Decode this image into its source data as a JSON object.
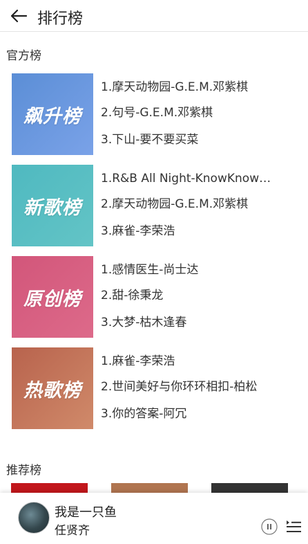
{
  "header": {
    "title": "排行榜",
    "back_icon": "arrow-left-icon"
  },
  "official": {
    "title": "官方榜",
    "charts": [
      {
        "cover_text": "飙升榜",
        "cover_colors": [
          "#5b8ed6",
          "#7aa2e8"
        ],
        "songs": [
          "1.摩天动物园-G.E.M.邓紫棋",
          "2.句号-G.E.M.邓紫棋",
          "3.下山-要不要买菜"
        ]
      },
      {
        "cover_text": "新歌榜",
        "cover_colors": [
          "#4fb9c0",
          "#63c4c6"
        ],
        "songs": [
          "1.R&B All Night-KnowKnow…",
          "2.摩天动物园-G.E.M.邓紫棋",
          "3.麻雀-李荣浩"
        ]
      },
      {
        "cover_text": "原创榜",
        "cover_colors": [
          "#d2567a",
          "#dd6a8a"
        ],
        "songs": [
          "1.感情医生-尚士达",
          "2.甜-徐秉龙",
          "3.大梦-枯木逢春"
        ]
      },
      {
        "cover_text": "热歌榜",
        "cover_colors": [
          "#b8634d",
          "#d08a6a"
        ],
        "songs": [
          "1.麻雀-李荣浩",
          "2.世间美好与你环环相扣-柏松",
          "3.你的答案-阿冗"
        ]
      }
    ]
  },
  "recommended": {
    "title": "推荐榜",
    "thumb_colors": [
      "#c2171c",
      "#b07550",
      "#333333"
    ]
  },
  "player": {
    "song": "我是一只鱼",
    "artist": "任贤齐",
    "pause_icon": "pause-icon",
    "playlist_icon": "playlist-icon"
  }
}
